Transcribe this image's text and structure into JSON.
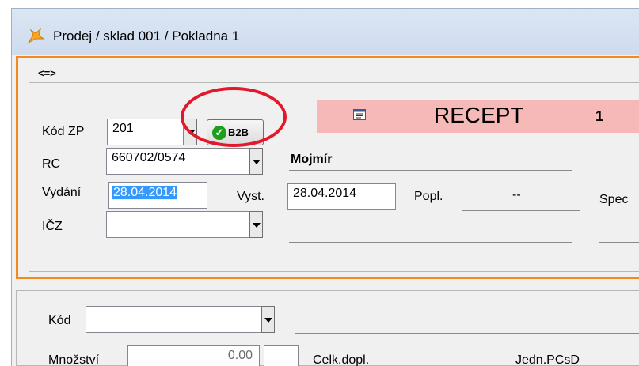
{
  "window": {
    "title": "Prodej / sklad 001 / Pokladna 1"
  },
  "toolbar": {
    "nav_arrows": "<=>"
  },
  "form": {
    "kod_zp": {
      "label": "Kód ZP",
      "value": "201"
    },
    "b2b_button": {
      "label": "B2B"
    },
    "recept": {
      "title": "RECEPT",
      "number": "1"
    },
    "rc": {
      "label": "RC",
      "value": "660702/0574"
    },
    "patient_name": "Mojmír",
    "vydani": {
      "label": "Vydání",
      "value": "28.04.2014"
    },
    "vyst": {
      "label": "Vyst.",
      "value": "28.04.2014"
    },
    "popl": {
      "label": "Popl.",
      "value": "--"
    },
    "spec": {
      "label": "Spec"
    },
    "icz": {
      "label": "IČZ",
      "value": ""
    }
  },
  "items": {
    "kod": {
      "label": "Kód",
      "value": ""
    },
    "mnozstvi": {
      "label": "Množství",
      "value": "0.00"
    },
    "celk_dopl": {
      "label": "Celk.dopl."
    },
    "jedn_pcsd": {
      "label": "Jedn.PCsD"
    }
  },
  "colors": {
    "accent_border": "#f28a1e",
    "recept_band": "#f7b8b8",
    "annotation": "#e3192b"
  }
}
